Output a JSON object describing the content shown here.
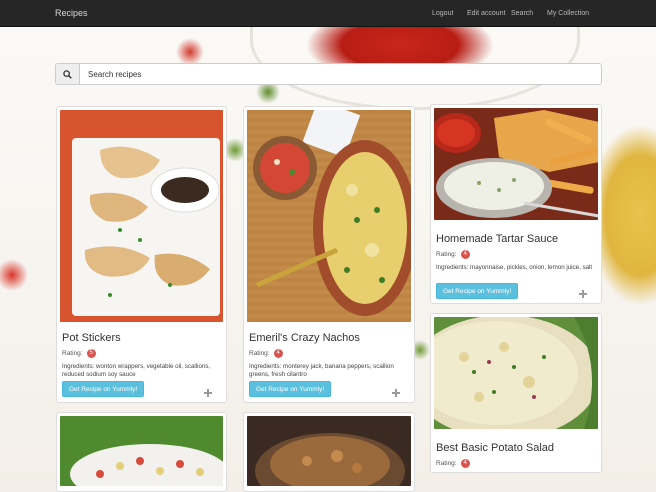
{
  "navbar": {
    "brand": "Recipes",
    "links": [
      {
        "label": "Logout",
        "name": "nav-logout"
      },
      {
        "label": "Edit account",
        "name": "nav-edit-account"
      },
      {
        "label": "Search",
        "name": "nav-search"
      },
      {
        "label": "My Collection",
        "name": "nav-my-collection"
      }
    ]
  },
  "search": {
    "placeholder": "Search recipes",
    "icon": "search-icon"
  },
  "rating_label": "Rating:",
  "button_label": "Get Recipe on Yummly!",
  "recipes": [
    {
      "title": "Pot Stickers",
      "rating": "5",
      "ingredients": "Ingredients: wonton wrappers, vegetable oil, scallions, reduced sodium soy sauce"
    },
    {
      "title": "Emeril's Crazy Nachos",
      "rating": "4",
      "ingredients": "Ingredients: monterey jack, banana peppers, scallion greens, fresh cilantro"
    },
    {
      "title": "Homemade Tartar Sauce",
      "rating": "4",
      "ingredients": "Ingredients: mayonnaise, pickles, onion, lemon juice, salt"
    },
    {
      "title": "Best Basic Potato Salad",
      "rating": "4"
    }
  ],
  "colors": {
    "navbar": "#262626",
    "button": "#5bc0de",
    "badge": "#d9534f"
  }
}
